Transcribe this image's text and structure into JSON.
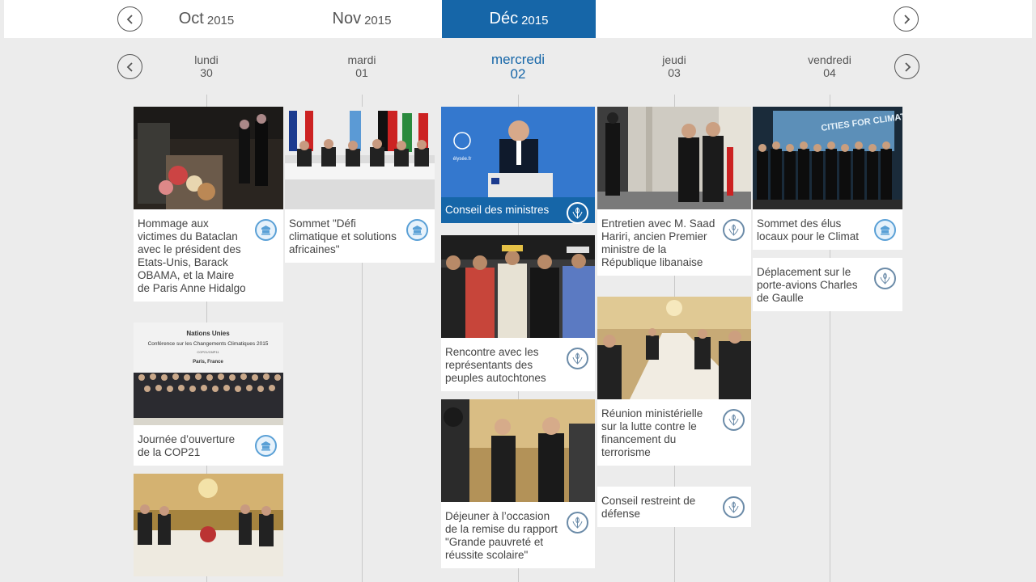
{
  "months": [
    {
      "name": "Oct",
      "year": "2015"
    },
    {
      "name": "Nov",
      "year": "2015"
    },
    {
      "name": "Déc",
      "year": "2015",
      "active": true
    }
  ],
  "days": [
    {
      "name": "lundi",
      "num": "30"
    },
    {
      "name": "mardi",
      "num": "01"
    },
    {
      "name": "mercredi",
      "num": "02",
      "active": true
    },
    {
      "name": "jeudi",
      "num": "03"
    },
    {
      "name": "vendredi",
      "num": "04"
    }
  ],
  "events": {
    "d30": [
      {
        "title": "Hommage aux victimes du Bataclan avec le président des Etats-Unis, Barack OBAMA, et la Maire de Paris Anne Hidalgo",
        "photo": "memorial-night"
      },
      {
        "title": "Journée d’ouverture de la COP21",
        "photo": "cop21-group",
        "photo_text": [
          "Nations Unies",
          "Conférence sur les Changements Climatiques 2015",
          "COP21/CMP11",
          "Paris, France"
        ]
      },
      {
        "title": "",
        "photo": "dinner-hall"
      }
    ],
    "d01": [
      {
        "title": "Sommet \"Défi climatique et solutions africaines\"",
        "photo": "summit-table"
      }
    ],
    "d02": [
      {
        "title": "Conseil des ministres",
        "photo": "minister-podium",
        "photo_text": [
          "élysée.fr"
        ]
      },
      {
        "title": "Rencontre avec les représentants des peuples autochtones",
        "photo": "indigenous-meeting"
      },
      {
        "title": "Déjeuner à l’occasion de la remise du rapport \"Grande pauvreté et réussite scolaire\"",
        "photo": "salon-lunch"
      }
    ],
    "d03": [
      {
        "title": "Entretien avec M. Saad Hariri, ancien Premier ministre de la République libanaise",
        "photo": "elysee-steps"
      },
      {
        "title": "Réunion ministérielle sur la lutte contre le financement du terrorisme",
        "photo": "conference-room"
      },
      {
        "title": "Conseil restreint de défense",
        "photo": ""
      }
    ],
    "d04": [
      {
        "title": "Sommet des élus locaux pour le Climat",
        "photo": "cities-climate",
        "photo_text": [
          "CITIES FOR CLIMATE"
        ]
      },
      {
        "title": "Déplacement sur le porte-avions Charles de Gaulle",
        "photo": ""
      }
    ]
  },
  "icons": {
    "prev": "chevron-left-icon",
    "next": "chevron-right-icon",
    "badge_president": "elysee-emblem-icon",
    "badge_minister": "ministry-emblem-icon"
  },
  "colors": {
    "accent": "#1666a8",
    "background": "#ececec",
    "text": "#444444"
  }
}
